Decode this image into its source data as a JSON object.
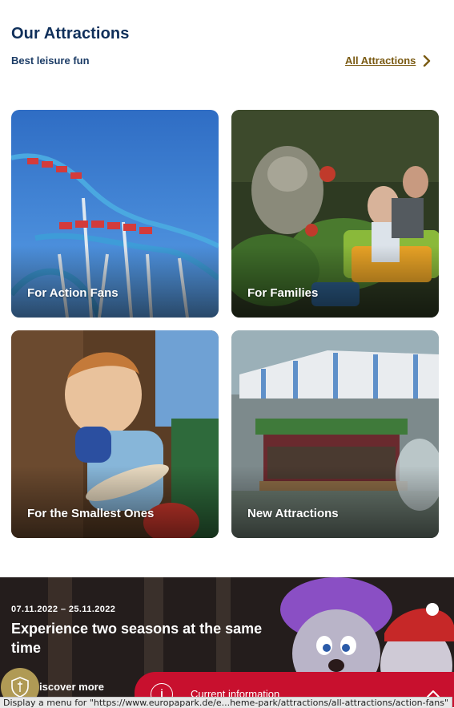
{
  "section": {
    "title": "Our Attractions",
    "subtitle": "Best leisure fun",
    "all_link": "All Attractions"
  },
  "cards": [
    {
      "label": "For Action Fans"
    },
    {
      "label": "For Families"
    },
    {
      "label": "For the Smallest Ones"
    },
    {
      "label": "New Attractions"
    }
  ],
  "promo": {
    "dates": "07.11.2022 – 25.11.2022",
    "headline": "Experience two seasons at the same time",
    "discover": "iscover more"
  },
  "info_bar": {
    "label": "Current information",
    "icon": "i"
  },
  "status_bar": {
    "text": "Display a menu for \"https://www.europapark.de/e...heme-park/attractions/all-attractions/action-fans\""
  },
  "colors": {
    "heading": "#0f2f5a",
    "link": "#7a5a12",
    "info_bar": "#c8102e",
    "shield": "#b09a55"
  }
}
